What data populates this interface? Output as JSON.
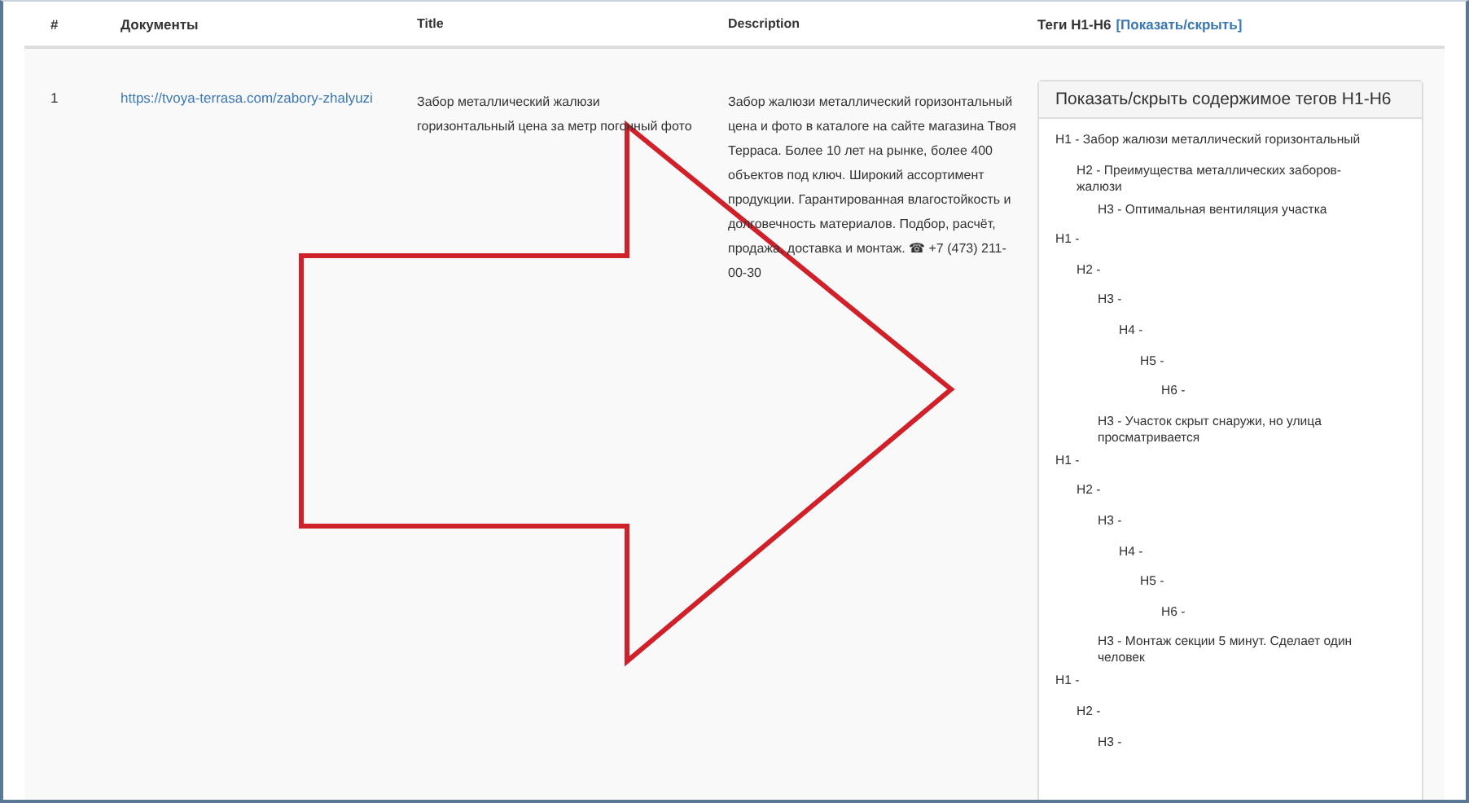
{
  "table": {
    "columns": [
      {
        "label": "#"
      },
      {
        "label": "Документы"
      },
      {
        "label": "Title"
      },
      {
        "label": "Description"
      },
      {
        "label": "Теги H1-H6",
        "link": "[Показать/скрыть]"
      }
    ],
    "rows": [
      {
        "number": "1",
        "url": "https://tvoya-terrasa.com/zabory-zhalyuzi",
        "title": "Забор металлический жалюзи горизонтальный цена за метр погонный фото",
        "description": "Забор жалюзи металлический горизонтальный цена и фото в каталоге на сайте магазина Твоя Терраса. Более 10 лет на рынке, более 400 объектов под ключ. Широкий ассортимент продукции. Гарантированная влагостойкость и долговечность материалов. Подбор, расчёт, продажа, доставка и монтаж. ☎ +7 (473) 211-00-30",
        "tags_panel": {
          "title": "Показать/скрыть содержимое тегов H1-H6",
          "tree": [
            {
              "label": "H1 - Забор жалюзи металлический горизонтальный",
              "children": [
                {
                  "label": "H2 - Преимущества металлических заборов-жалюзи",
                  "children": [
                    {
                      "label": "H3 - Оптимальная вентиляция участка"
                    }
                  ]
                }
              ]
            },
            {
              "label": "H1 -",
              "children": [
                {
                  "label": "H2 -",
                  "children": [
                    {
                      "label": "H3 -",
                      "children": [
                        {
                          "label": "H4 -",
                          "children": [
                            {
                              "label": "H5 -",
                              "children": [
                                {
                                  "label": "H6 -"
                                }
                              ]
                            }
                          ]
                        }
                      ]
                    },
                    {
                      "label": "H3 - Участок скрыт снаружи, но улица просматривается"
                    }
                  ]
                }
              ]
            },
            {
              "label": "H1 -",
              "children": [
                {
                  "label": "H2 -",
                  "children": [
                    {
                      "label": "H3 -",
                      "children": [
                        {
                          "label": "H4 -",
                          "children": [
                            {
                              "label": "H5 -",
                              "children": [
                                {
                                  "label": "H6 -"
                                }
                              ]
                            }
                          ]
                        }
                      ]
                    },
                    {
                      "label": "H3 - Монтаж секции 5 минут. Сделает один человек"
                    }
                  ]
                }
              ]
            },
            {
              "label": "H1 -",
              "children": [
                {
                  "label": "H2 -",
                  "children": [
                    {
                      "label": "H3 -"
                    }
                  ]
                }
              ]
            }
          ]
        }
      }
    ]
  }
}
